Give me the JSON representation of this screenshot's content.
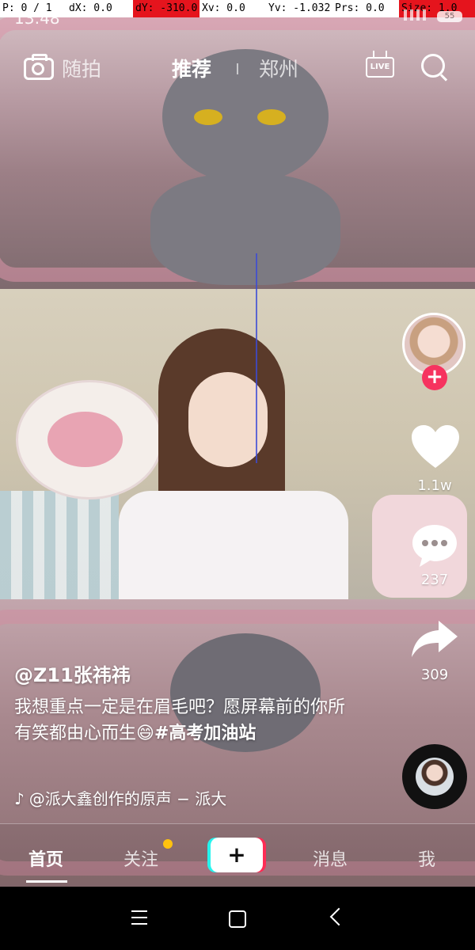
{
  "debug_hud": {
    "pointer": "P: 0 / 1",
    "dx": "dX: 0.0",
    "dy": "dY: -310.0",
    "xv": "Xv: 0.0",
    "yv": "Yv: -1.032",
    "prs": "Prs: 0.0",
    "size": "Size: 1.0"
  },
  "status_bar": {
    "time": "13:48",
    "battery": "55"
  },
  "top_nav": {
    "camera_label": "随拍",
    "tab_recommend": "推荐",
    "tab_city": "郑州",
    "live_label": "LIVE"
  },
  "right_rail": {
    "likes": "1.1w",
    "comments": "237",
    "shares": "309"
  },
  "caption": {
    "username": "@Z11张祎祎",
    "text": "我想重点一定是在眉毛吧？愿屏幕前的你所有笑都由心而生😄",
    "hashtag": "#高考加油站",
    "music": "@派大鑫创作的原声 − 派大"
  },
  "tab_bar": {
    "home": "首页",
    "follow": "关注",
    "create": "+",
    "messages": "消息",
    "me": "我"
  },
  "colors": {
    "accent_red": "#f6335f",
    "notify_yellow": "#ffc20e",
    "tiktok_cyan": "#25f4ee",
    "tiktok_red": "#fe2c55"
  }
}
